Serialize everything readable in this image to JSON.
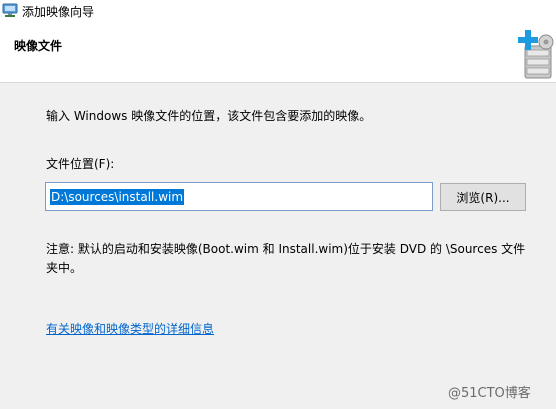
{
  "window": {
    "title": "添加映像向导",
    "title_icon": "wizard-image-icon"
  },
  "header": {
    "title": "映像文件",
    "icon": "add-image-icon"
  },
  "content": {
    "intro": "输入 Windows 映像文件的位置，该文件包含要添加的映像。",
    "field_label": "文件位置(F):",
    "path_value": "D:\\sources\\install.wim",
    "browse_label": "浏览(R)...",
    "note": "注意: 默认的启动和安装映像(Boot.wim 和 Install.wim)位于安装 DVD 的 \\Sources 文件夹中。",
    "link_text": "有关映像和映像类型的详细信息"
  },
  "watermark": "@51CTO博客",
  "colors": {
    "selection": "#0078d7",
    "link": "#0066cc",
    "accent_plus": "#1e9be0"
  }
}
